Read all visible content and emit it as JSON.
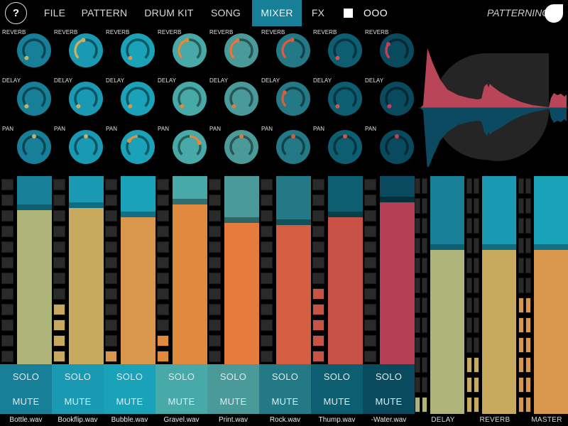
{
  "topbar": {
    "help_label": "?",
    "nav": [
      {
        "id": "file",
        "label": "FILE",
        "active": false
      },
      {
        "id": "pattern",
        "label": "PATTERN",
        "active": false
      },
      {
        "id": "drum-kit",
        "label": "DRUM KIT",
        "active": false
      },
      {
        "id": "song",
        "label": "SONG",
        "active": false
      },
      {
        "id": "mixer",
        "label": "MIXER",
        "active": true
      },
      {
        "id": "fx",
        "label": "FX",
        "active": false
      }
    ],
    "stop_icon": "stop-square",
    "more_label": "OOO",
    "brand": "PATTERNING",
    "logo_icon": "leaf-drop-logo"
  },
  "knob_labels": {
    "reverb": "REVERB",
    "delay": "DELAY",
    "pan": "PAN"
  },
  "colors": {
    "active_tab": "#177f98",
    "meter_off": "#2a2a2a"
  },
  "channels": [
    {
      "name": "Bottle.wav",
      "bg": "#177f98",
      "cap": "#0f5f72",
      "fill": "#aeb47a",
      "knob": "#177f98",
      "accent": "#c9b25f",
      "reverb": 0.0,
      "delay": 0.0,
      "pan": 0.5,
      "level": 0.82,
      "meter_lit": 0,
      "solo": "SOLO",
      "mute": "MUTE"
    },
    {
      "name": "Bookflip.wav",
      "bg": "#1a99b2",
      "cap": "#106d80",
      "fill": "#c7aa5e",
      "knob": "#1a99b2",
      "accent": "#c9b25f",
      "reverb": 0.45,
      "delay": 0.0,
      "pan": 0.5,
      "level": 0.83,
      "meter_lit": 4,
      "solo": "SOLO",
      "mute": "MUTE"
    },
    {
      "name": "Bubble.wav",
      "bg": "#1aa2b8",
      "cap": "#117083",
      "fill": "#d9974d",
      "knob": "#1aa2b8",
      "accent": "#e0914a",
      "reverb": 0.0,
      "delay": 0.0,
      "pan": 0.3,
      "level": 0.78,
      "meter_lit": 1,
      "solo": "SOLO",
      "mute": "MUTE"
    },
    {
      "name": "Gravel.wav",
      "bg": "#47aaa8",
      "cap": "#2c6f6e",
      "fill": "#df8a3f",
      "knob": "#47aaa8",
      "accent": "#e48a3c",
      "reverb": 0.45,
      "delay": 0.0,
      "pan": 0.75,
      "level": 0.85,
      "meter_lit": 2,
      "solo": "SOLO",
      "mute": "MUTE"
    },
    {
      "name": "Print.wav",
      "bg": "#4b9a9a",
      "cap": "#2e6666",
      "fill": "#e67c3b",
      "knob": "#4b9a9a",
      "accent": "#e6783a",
      "reverb": 0.42,
      "delay": 0.0,
      "pan": 0.5,
      "level": 0.75,
      "meter_lit": 0,
      "solo": "SOLO",
      "mute": "MUTE"
    },
    {
      "name": "Rock.wav",
      "bg": "#237a86",
      "cap": "#174f58",
      "fill": "#d45e42",
      "knob": "#237a86",
      "accent": "#d95e40",
      "reverb": 0.48,
      "delay": 0.3,
      "pan": 0.5,
      "level": 0.74,
      "meter_lit": 0,
      "solo": "SOLO",
      "mute": "MUTE"
    },
    {
      "name": "Thump.wav",
      "bg": "#0c5e70",
      "cap": "#073f4b",
      "fill": "#c95246",
      "knob": "#0c5e70",
      "accent": "#d85448",
      "reverb": 0.0,
      "delay": 0.0,
      "pan": 0.5,
      "level": 0.78,
      "meter_lit": 5,
      "solo": "SOLO",
      "mute": "MUTE"
    },
    {
      "name": "-Water.wav",
      "bg": "#0a4a5e",
      "cap": "#062f3c",
      "fill": "#b53f55",
      "knob": "#0a4a5e",
      "accent": "#c83e55",
      "reverb": 0.3,
      "delay": 0.0,
      "pan": 0.5,
      "level": 0.86,
      "meter_lit": 0,
      "solo": "SOLO",
      "mute": "MUTE"
    }
  ],
  "buses": [
    {
      "name": "DELAY",
      "bg": "#177f98",
      "cap": "#0f5f72",
      "fill": "#aeb47a",
      "level": 0.69,
      "meter_lit": 1
    },
    {
      "name": "REVERB",
      "bg": "#1a99b2",
      "cap": "#106d80",
      "fill": "#c7aa5e",
      "level": 0.69,
      "meter_lit": 3
    },
    {
      "name": "MASTER",
      "bg": "#1aa2b8",
      "cap": "#117083",
      "fill": "#d9974d",
      "level": 0.69,
      "meter_lit": 6
    }
  ],
  "waveform": {
    "top_color": "#b84558",
    "bottom_color": "#0b4a60",
    "backdrop_color": "#252525"
  }
}
